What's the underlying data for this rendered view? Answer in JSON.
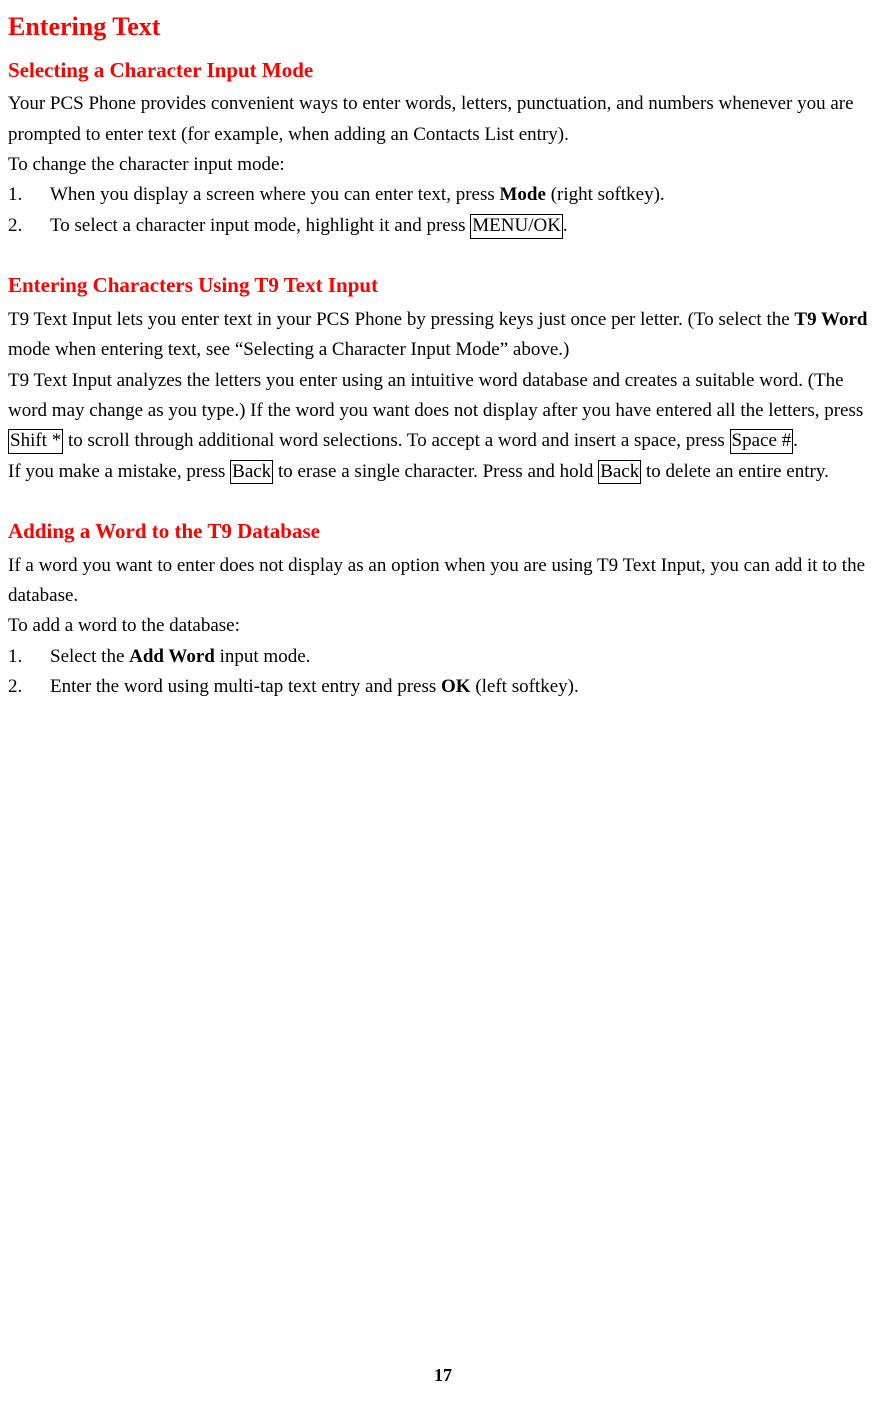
{
  "title": "Entering Text",
  "sections": {
    "selecting": {
      "heading": "Selecting a Character Input Mode",
      "intro1": "Your PCS Phone provides convenient ways to enter words, letters, punctuation, and numbers whenever you are prompted to enter text (for example, when adding an Contacts List entry).",
      "intro2": "To change the character input mode:",
      "step1_a": "When you display a screen where you can enter text, press ",
      "step1_mode": "Mode",
      "step1_b": " (right softkey).",
      "step2_a": "To select a character input mode, highlight it and press ",
      "step2_key": "MENU/OK",
      "step2_b": "."
    },
    "t9input": {
      "heading": "Entering Characters Using T9 Text Input",
      "p1_a": "T9 Text Input lets you enter text in your PCS Phone by pressing keys just once per letter. (To select the ",
      "p1_bold": "T9 Word",
      "p1_b": " mode when entering text, see “Selecting a Character Input Mode” above.)",
      "p2_a": "T9 Text Input analyzes the letters you enter using an intuitive word database and creates a suitable word. (The word may change as you type.) If the word you want does not display after you have entered all the letters, press ",
      "p2_key1": "Shift *",
      "p2_b": " to scroll through additional word selections. To accept a word and insert a space, press ",
      "p2_key2": "Space #",
      "p2_c": ".",
      "p3_a": "If you make a mistake, press ",
      "p3_key1": "Back",
      "p3_b": " to erase a single character. Press and hold ",
      "p3_key2": "Back",
      "p3_c": " to delete an entire entry."
    },
    "addword": {
      "heading": "Adding a Word to the T9 Database",
      "intro1": "If a word you want to enter does not display as an option when you are using T9 Text Input, you can add it to the database.",
      "intro2": "To add a word to the database:",
      "step1_a": "Select the ",
      "step1_bold": "Add Word",
      "step1_b": " input mode.",
      "step2_a": "Enter the word using multi-tap text entry and press ",
      "step2_bold": "OK",
      "step2_b": " (left softkey)."
    }
  },
  "page_number": "17"
}
